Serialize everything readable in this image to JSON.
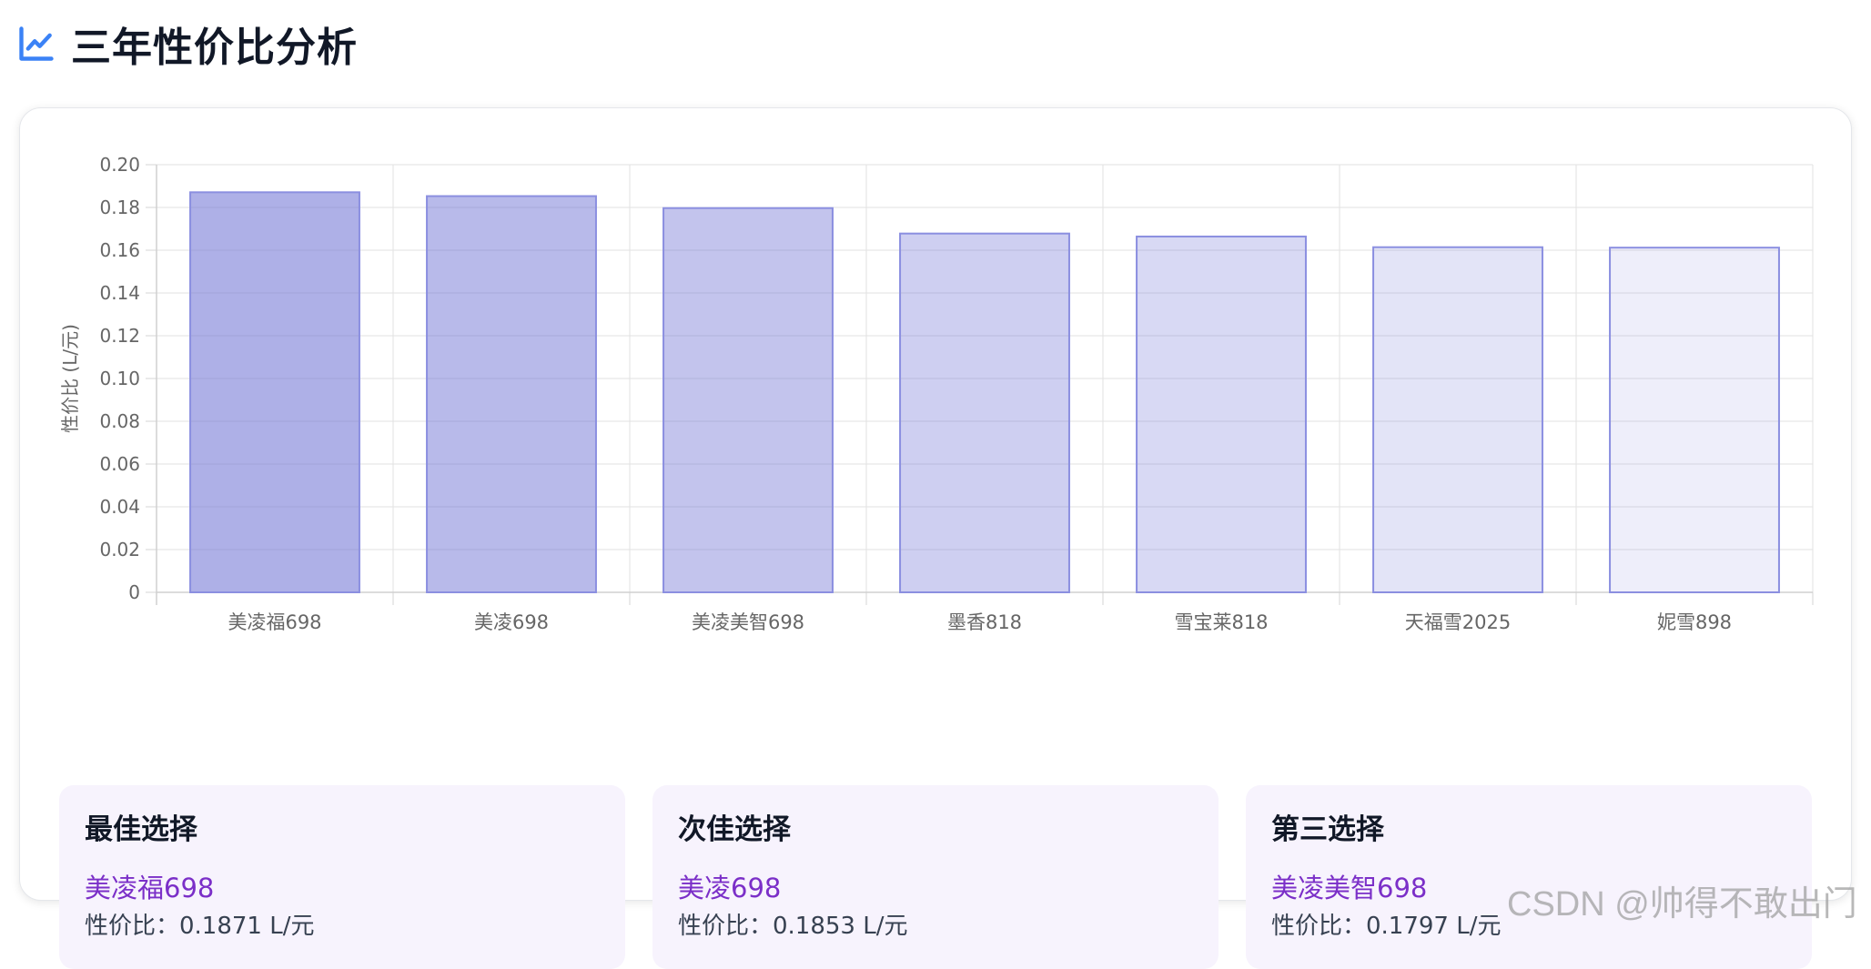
{
  "header": {
    "title": "三年性价比分析",
    "icon": "line-chart-icon",
    "icon_color": "#3b82f6"
  },
  "chart_data": {
    "type": "bar",
    "categories": [
      "美凌福698",
      "美凌698",
      "美凌美智698",
      "墨香818",
      "雪宝莱818",
      "天福雪2025",
      "妮雪898"
    ],
    "values": [
      0.1871,
      0.1853,
      0.1797,
      0.1678,
      0.1664,
      0.1614,
      0.1612
    ],
    "title": "",
    "xlabel": "",
    "ylabel": "性价比 (L/元)",
    "ylim": [
      0,
      0.2
    ],
    "yticks": [
      "0",
      "0.02",
      "0.04",
      "0.06",
      "0.08",
      "0.10",
      "0.12",
      "0.14",
      "0.16",
      "0.18",
      "0.20"
    ],
    "grid": true,
    "bar_fill_base": "#6b6fd4",
    "bar_border": "#8b8fe0"
  },
  "picks": [
    {
      "title": "最佳选择",
      "name": "美凌福698",
      "value": "性价比：0.1871 L/元"
    },
    {
      "title": "次佳选择",
      "name": "美凌698",
      "value": "性价比：0.1853 L/元"
    },
    {
      "title": "第三选择",
      "name": "美凌美智698",
      "value": "性价比：0.1797 L/元"
    }
  ],
  "watermark": "CSDN @帅得不敢出门"
}
